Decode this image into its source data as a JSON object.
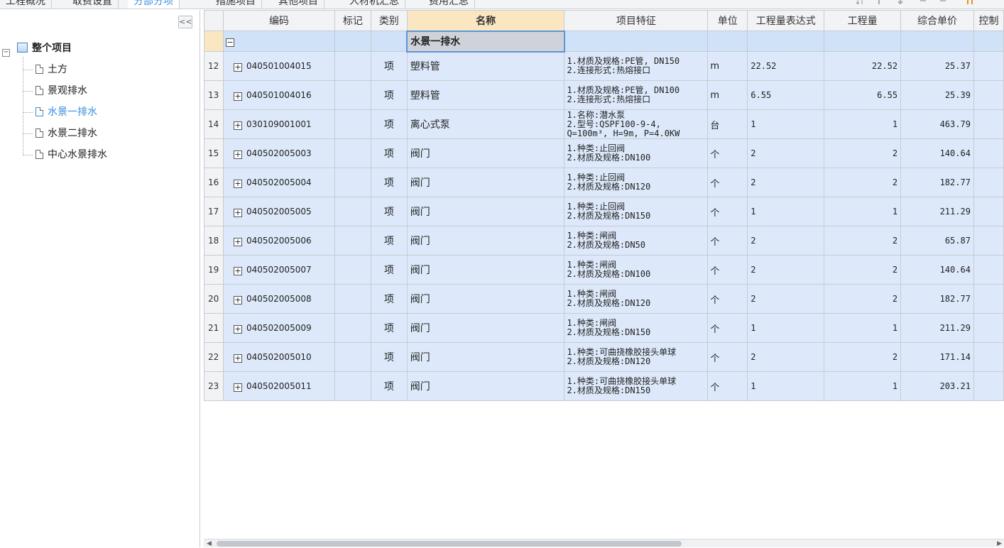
{
  "tabs": [
    {
      "label": "工程概况",
      "active": false
    },
    {
      "label": "取费设置",
      "active": false
    },
    {
      "label": "分部分项",
      "active": true
    },
    {
      "label": "措施项目",
      "active": false
    },
    {
      "label": "其他项目",
      "active": false
    },
    {
      "label": "人材机汇总",
      "active": false
    },
    {
      "label": "费用汇总",
      "active": false
    }
  ],
  "toolbar_icons": [
    "sort-icon",
    "move-up-icon",
    "move-down-icon",
    "move-left-icon",
    "move-right-icon",
    "swap-icon"
  ],
  "tree": {
    "collapse_glyph": "<<",
    "root": {
      "label": "整个项目",
      "expander": "−"
    },
    "children": [
      {
        "label": "土方",
        "selected": false
      },
      {
        "label": "景观排水",
        "selected": false
      },
      {
        "label": "水景一排水",
        "selected": true
      },
      {
        "label": "水景二排水",
        "selected": false
      },
      {
        "label": "中心水景排水",
        "selected": false
      }
    ]
  },
  "grid": {
    "columns": [
      "",
      "编码",
      "标记",
      "类别",
      "名称",
      "项目特征",
      "单位",
      "工程量表达式",
      "工程量",
      "综合单价",
      "控制"
    ],
    "section": {
      "toggle": "−",
      "name": "水景一排水"
    },
    "rows": [
      {
        "no": "12",
        "code": "040501004015",
        "mark": "",
        "type": "项",
        "name": "塑料管",
        "feature": "1.材质及规格:PE管, DN150\n2.连接形式:热熔接口",
        "unit": "m",
        "expr": "22.52",
        "qty": "22.52",
        "price": "25.37"
      },
      {
        "no": "13",
        "code": "040501004016",
        "mark": "",
        "type": "项",
        "name": "塑料管",
        "feature": "1.材质及规格:PE管, DN100\n2.连接形式:热熔接口",
        "unit": "m",
        "expr": "6.55",
        "qty": "6.55",
        "price": "25.39"
      },
      {
        "no": "14",
        "code": "030109001001",
        "mark": "",
        "type": "项",
        "name": "离心式泵",
        "feature": "1.名称:潜水泵\n2.型号:QSPF100-9-4,\nQ=100m³, H=9m, P=4.0KW",
        "unit": "台",
        "expr": "1",
        "qty": "1",
        "price": "463.79"
      },
      {
        "no": "15",
        "code": "040502005003",
        "mark": "",
        "type": "项",
        "name": "阀门",
        "feature": "1.种类:止回阀\n2.材质及规格:DN100",
        "unit": "个",
        "expr": "2",
        "qty": "2",
        "price": "140.64"
      },
      {
        "no": "16",
        "code": "040502005004",
        "mark": "",
        "type": "项",
        "name": "阀门",
        "feature": "1.种类:止回阀\n2.材质及规格:DN120",
        "unit": "个",
        "expr": "2",
        "qty": "2",
        "price": "182.77"
      },
      {
        "no": "17",
        "code": "040502005005",
        "mark": "",
        "type": "项",
        "name": "阀门",
        "feature": "1.种类:止回阀\n2.材质及规格:DN150",
        "unit": "个",
        "expr": "1",
        "qty": "1",
        "price": "211.29"
      },
      {
        "no": "18",
        "code": "040502005006",
        "mark": "",
        "type": "项",
        "name": "阀门",
        "feature": "1.种类:闸阀\n2.材质及规格:DN50",
        "unit": "个",
        "expr": "2",
        "qty": "2",
        "price": "65.87"
      },
      {
        "no": "19",
        "code": "040502005007",
        "mark": "",
        "type": "项",
        "name": "阀门",
        "feature": "1.种类:闸阀\n2.材质及规格:DN100",
        "unit": "个",
        "expr": "2",
        "qty": "2",
        "price": "140.64"
      },
      {
        "no": "20",
        "code": "040502005008",
        "mark": "",
        "type": "项",
        "name": "阀门",
        "feature": "1.种类:闸阀\n2.材质及规格:DN120",
        "unit": "个",
        "expr": "2",
        "qty": "2",
        "price": "182.77"
      },
      {
        "no": "21",
        "code": "040502005009",
        "mark": "",
        "type": "项",
        "name": "阀门",
        "feature": "1.种类:闸阀\n2.材质及规格:DN150",
        "unit": "个",
        "expr": "1",
        "qty": "1",
        "price": "211.29"
      },
      {
        "no": "22",
        "code": "040502005010",
        "mark": "",
        "type": "项",
        "name": "阀门",
        "feature": "1.种类:可曲挠橡胶接头单球\n2.材质及规格:DN120",
        "unit": "个",
        "expr": "2",
        "qty": "2",
        "price": "171.14"
      },
      {
        "no": "23",
        "code": "040502005011",
        "mark": "",
        "type": "项",
        "name": "阀门",
        "feature": "1.种类:可曲挠橡胶接头单球\n2.材质及规格:DN150",
        "unit": "个",
        "expr": "1",
        "qty": "1",
        "price": "203.21"
      }
    ],
    "row_toggle": "+"
  },
  "scrollbar": {
    "left_arrow": "◀",
    "right_arrow": "▶"
  },
  "colors": {
    "accent": "#3b8fe0",
    "row_bg": "#dde9fa",
    "header_name_bg": "#fbe6c2",
    "selected_border": "#5b95d6"
  }
}
